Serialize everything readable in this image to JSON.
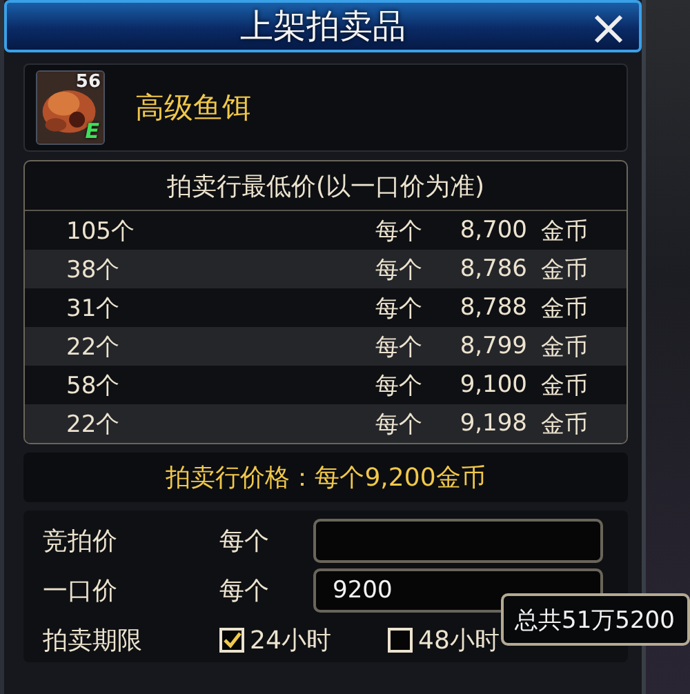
{
  "window": {
    "title": "上架拍卖品"
  },
  "item": {
    "name": "高级鱼饵",
    "count": "56",
    "grade": "E"
  },
  "lowest_prices": {
    "title": "拍卖行最低价(以一口价为准)",
    "rows": [
      {
        "quantity": "105个",
        "per": "每个",
        "price": "8,700",
        "currency": "金币"
      },
      {
        "quantity": "38个",
        "per": "每个",
        "price": "8,786",
        "currency": "金币"
      },
      {
        "quantity": "31个",
        "per": "每个",
        "price": "8,788",
        "currency": "金币"
      },
      {
        "quantity": "22个",
        "per": "每个",
        "price": "8,799",
        "currency": "金币"
      },
      {
        "quantity": "58个",
        "per": "每个",
        "price": "9,100",
        "currency": "金币"
      },
      {
        "quantity": "22个",
        "per": "每个",
        "price": "9,198",
        "currency": "金币"
      }
    ]
  },
  "auction_price": "拍卖行价格：每个9,200金币",
  "form": {
    "fields": [
      {
        "label": "竞拍价",
        "per": "每个"
      },
      {
        "label": "一口价",
        "per": "每个",
        "value": "9200"
      }
    ],
    "tooltip": "总共51万5200",
    "duration": {
      "label": "拍卖期限",
      "options": [
        {
          "label": "24小时",
          "checked": true
        },
        {
          "label": "48小时",
          "checked": false
        }
      ]
    }
  }
}
